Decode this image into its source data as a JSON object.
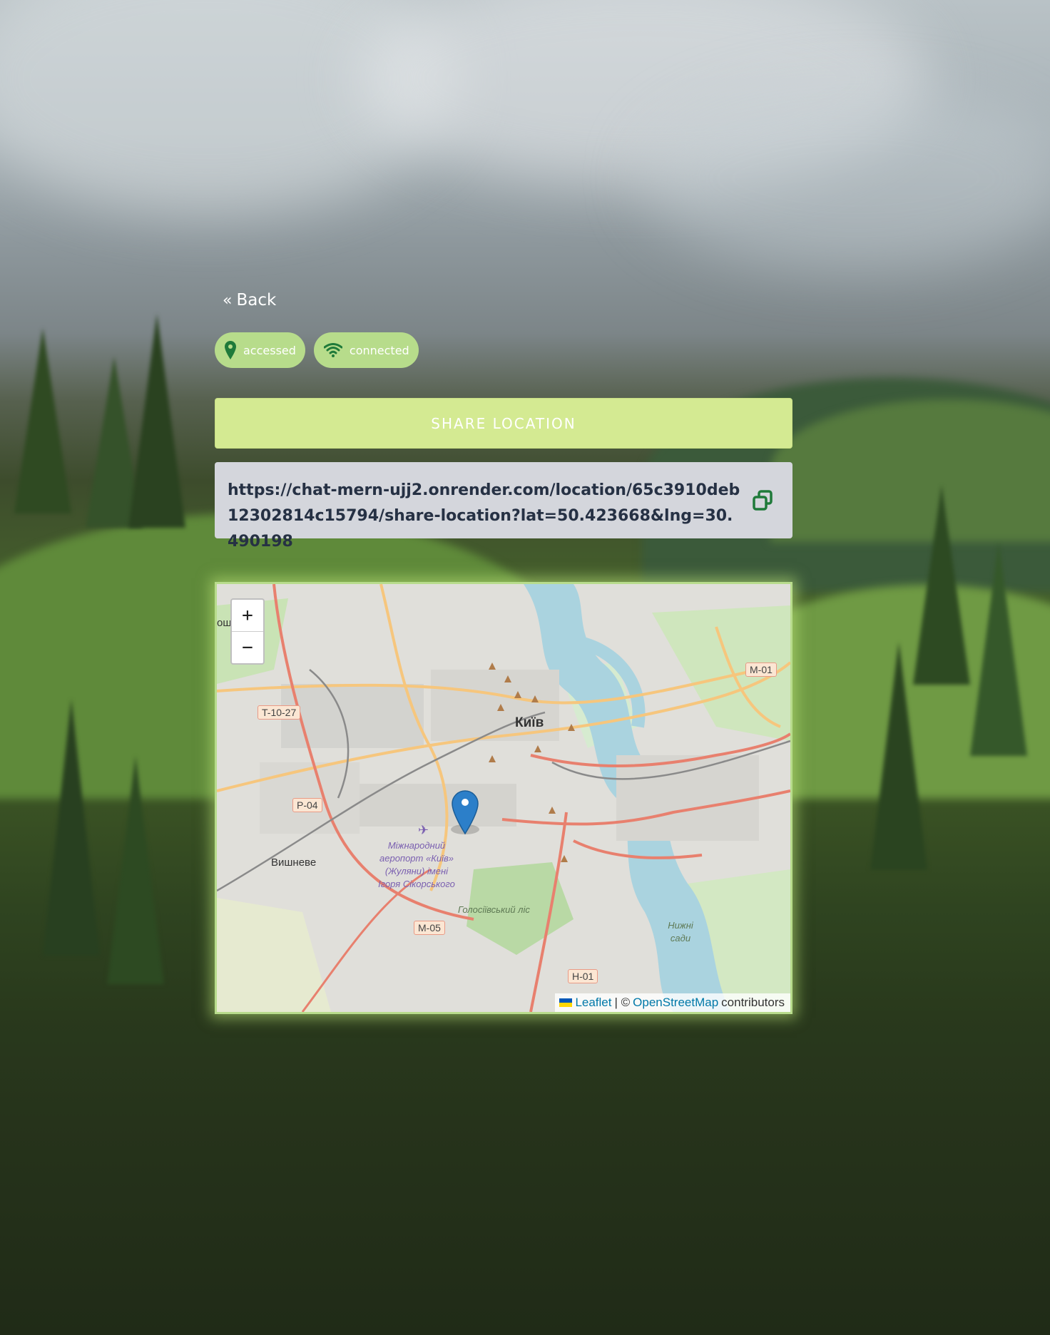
{
  "nav": {
    "back_label": "Back"
  },
  "status": {
    "location_badge": "accessed",
    "connection_badge": "connected"
  },
  "actions": {
    "share_label": "SHARE LOCATION"
  },
  "share_link": {
    "url": "https://chat-mern-ujj2.onrender.com/location/65c3910deb12302814c15794/share-location?lat=50.423668&lng=30.490198"
  },
  "map": {
    "zoom_in_label": "+",
    "zoom_out_label": "−",
    "attribution": {
      "leaflet": "Leaflet",
      "separator": "| ©",
      "osm": "OpenStreetMap",
      "suffix": "contributors"
    },
    "labels": {
      "city": "Київ",
      "village_west": "Вишневе",
      "village_nw": "ощ  ське",
      "airport": "Міжнародний аеропорт «Київ» (Жуляни) імені Ігоря Сікорського",
      "forest": "Голосіївський ліс",
      "gardens": "Нижні сади"
    },
    "roads": [
      "M-01",
      "T-10-27",
      "P-04",
      "M-05",
      "H-01"
    ]
  },
  "colors": {
    "badge": "#b7dc8b",
    "share_button": "#d4ea92",
    "link_box": "#d4d6dc",
    "icon_green": "#1f7a3a"
  }
}
